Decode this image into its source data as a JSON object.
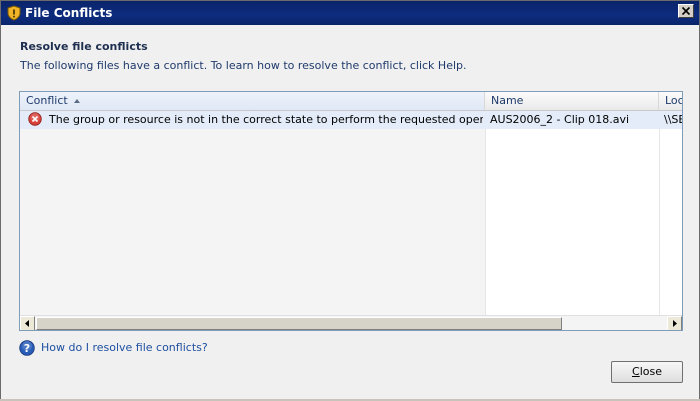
{
  "window": {
    "title": "File Conflicts"
  },
  "dialog": {
    "heading": "Resolve file conflicts",
    "description": "The following files have a conflict. To learn how to resolve the conflict, click Help."
  },
  "list": {
    "columns": [
      "Conflict",
      "Name",
      "Loc"
    ],
    "sorted_column": "Conflict",
    "sort_direction": "ascending",
    "rows": [
      {
        "icon": "error-icon",
        "conflict": "The group or resource is not in the correct state to perform the requested operation",
        "name": "AUS2006_2 - Clip 018.avi",
        "location": "\\\\SE"
      }
    ]
  },
  "help": {
    "link_text": "How do I resolve file conflicts?",
    "icon": "help-icon"
  },
  "buttons": {
    "close_mnemonic": "C",
    "close_rest": "lose"
  },
  "colors": {
    "title_bar": "#0a246a",
    "link": "#1d4fa1",
    "error": "#c0302a",
    "selected_row": "#e3ecf8"
  }
}
